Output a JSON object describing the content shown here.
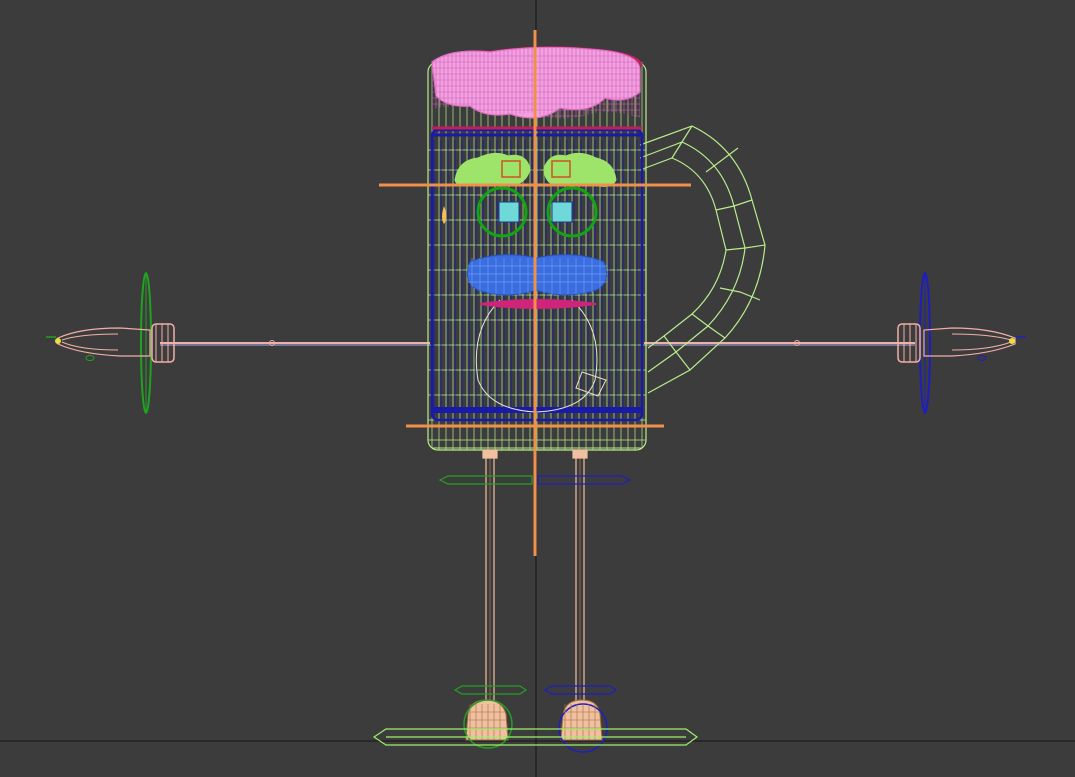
{
  "viewport": {
    "view": "front-orthographic",
    "background": "#3c3c3c",
    "grid_axis_color": "#1e1e1e",
    "render_mode": "wireframe"
  },
  "scene": {
    "model": "beer-mug-character",
    "colors": {
      "mug_body": "#b8ec8c",
      "mug_liquid": "#1a1aa8",
      "foam": "#f08ad8",
      "foam_rim": "#c0205a",
      "eyebrows": "#9ee46a",
      "eye_rings": "#12a412",
      "pupils": "#6fd8d8",
      "mustache": "#3a6ee0",
      "lips": "#d0247a",
      "hands": "#f2b0a8",
      "legs": "#f0c0a0",
      "bone_control": "#f0904a",
      "left_controls": "#22a022",
      "right_controls": "#1e1ec0",
      "foot_bar": "#9ef06c"
    }
  }
}
